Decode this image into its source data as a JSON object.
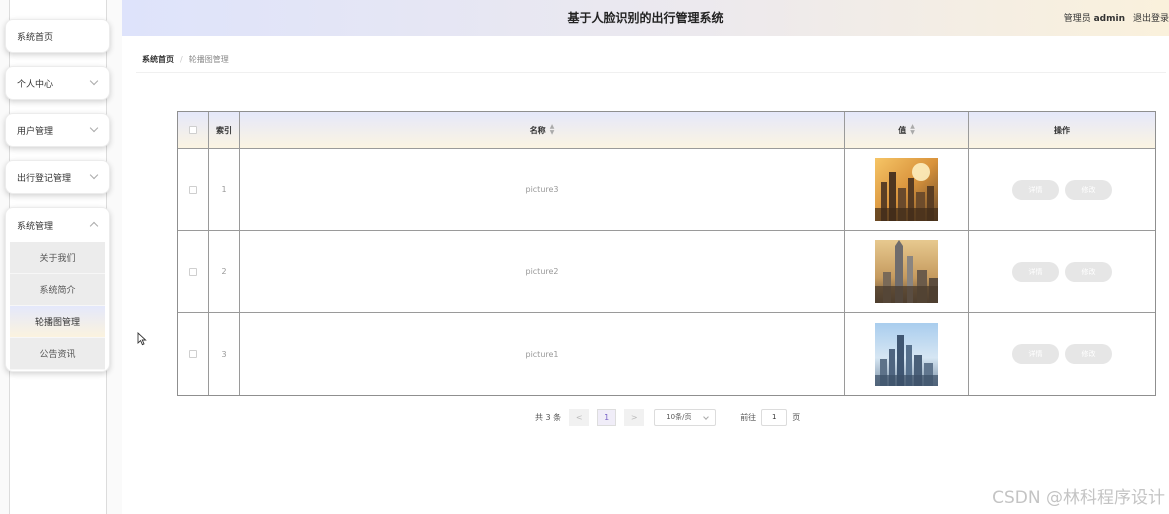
{
  "header": {
    "title": "基于人脸识别的出行管理系统",
    "admin_prefix": "管理员",
    "admin_name": "admin",
    "logout": "退出登录"
  },
  "sidebar": {
    "items": [
      {
        "label": "系统首页"
      },
      {
        "label": "个人中心"
      },
      {
        "label": "用户管理"
      },
      {
        "label": "出行登记管理"
      }
    ],
    "group": {
      "label": "系统管理",
      "children": [
        {
          "label": "关于我们"
        },
        {
          "label": "系统简介"
        },
        {
          "label": "轮播图管理"
        },
        {
          "label": "公告资讯"
        }
      ]
    }
  },
  "breadcrumb": {
    "home": "系统首页",
    "current": "轮播图管理"
  },
  "table": {
    "columns": {
      "index": "索引",
      "name": "名称",
      "value": "值",
      "actions": "操作"
    },
    "rows": [
      {
        "index": "1",
        "name": "picture3",
        "thumb": "city-sunset"
      },
      {
        "index": "2",
        "name": "picture2",
        "thumb": "city-towers"
      },
      {
        "index": "3",
        "name": "picture1",
        "thumb": "city-skyline-blue"
      }
    ],
    "detail_label": "详情",
    "edit_label": "修改"
  },
  "pagination": {
    "total_text": "共 3 条",
    "prev": "<",
    "current_page": "1",
    "next": ">",
    "page_size": "10条/页",
    "goto_label": "前往",
    "goto_value": "1",
    "page_unit": "页"
  },
  "watermark": "CSDN @林科程序设计",
  "colors": {
    "header_start": "#dee3fb",
    "header_end": "#faf1dc",
    "active_page": "#7a63c8",
    "button_bg": "#e6e6e6"
  }
}
